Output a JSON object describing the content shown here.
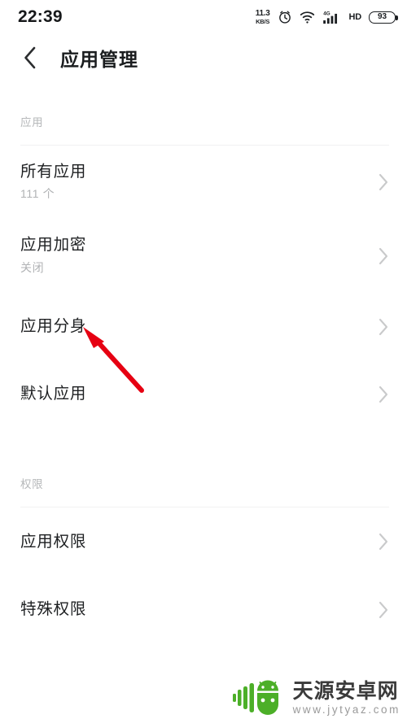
{
  "status_bar": {
    "time": "22:39",
    "network_speed_value": "11.3",
    "network_speed_unit": "KB/S",
    "alarm_icon": "alarm-clock-icon",
    "wifi_icon": "wifi-icon",
    "signal_icon": "cellular-signal-4g-icon",
    "signal_label": "4G",
    "hd_label": "HD",
    "battery_percent": "93"
  },
  "header": {
    "back_icon": "chevron-left-icon",
    "title": "应用管理"
  },
  "sections": [
    {
      "label": "应用",
      "rows": [
        {
          "title": "所有应用",
          "subtitle": "111 个",
          "chevron": "chevron-right-icon"
        },
        {
          "title": "应用加密",
          "subtitle": "关闭",
          "chevron": "chevron-right-icon"
        },
        {
          "title": "应用分身",
          "subtitle": "",
          "chevron": "chevron-right-icon"
        },
        {
          "title": "默认应用",
          "subtitle": "",
          "chevron": "chevron-right-icon"
        }
      ]
    },
    {
      "label": "权限",
      "rows": [
        {
          "title": "应用权限",
          "subtitle": "",
          "chevron": "chevron-right-icon"
        },
        {
          "title": "特殊权限",
          "subtitle": "",
          "chevron": "chevron-right-icon"
        }
      ]
    }
  ],
  "annotation": {
    "type": "arrow",
    "color": "#e60012",
    "points_to": "应用分身"
  },
  "watermark": {
    "logo": "android-robot-logo",
    "site_name": "天源安卓网",
    "site_url": "www.jytyaz.com",
    "logo_color": "#4caf28"
  },
  "colors": {
    "background": "#ffffff",
    "primary_text": "#1d1f21",
    "secondary_text": "#b0b2b4",
    "section_label": "#b6b8ba",
    "divider": "#f1f1f2",
    "chevron": "#c9cacb",
    "annotation_red": "#e60012"
  }
}
